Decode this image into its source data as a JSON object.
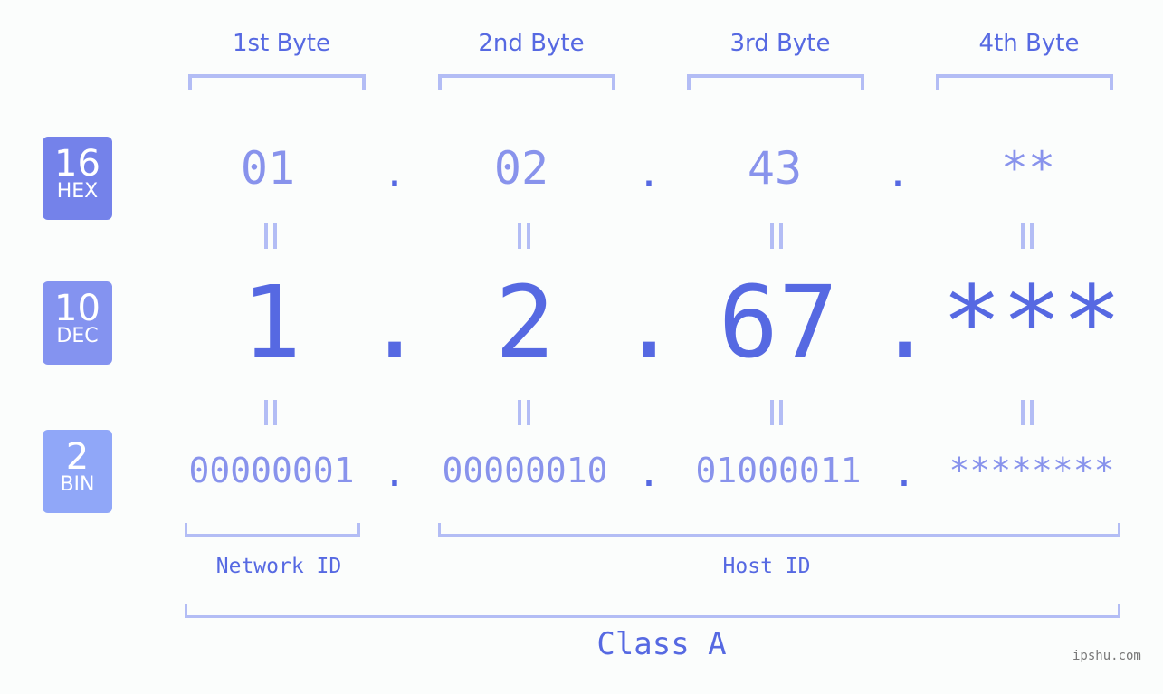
{
  "bytes": [
    {
      "label": "1st Byte",
      "hex": "01",
      "dec": "1",
      "bin": "00000001"
    },
    {
      "label": "2nd Byte",
      "hex": "02",
      "dec": "2",
      "bin": "00000010"
    },
    {
      "label": "3rd Byte",
      "hex": "43",
      "dec": "67",
      "bin": "01000011"
    },
    {
      "label": "4th Byte",
      "hex": "**",
      "dec": "***",
      "bin": "********"
    }
  ],
  "badges": [
    {
      "num": "16",
      "label": "HEX",
      "color": "#7482ea"
    },
    {
      "num": "10",
      "label": "DEC",
      "color": "#8493f0"
    },
    {
      "num": "2",
      "label": "BIN",
      "color": "#90a7f8"
    }
  ],
  "separator": ".",
  "network_label": "Network ID",
  "host_label": "Host ID",
  "class_label": "Class A",
  "watermark": "ipshu.com"
}
